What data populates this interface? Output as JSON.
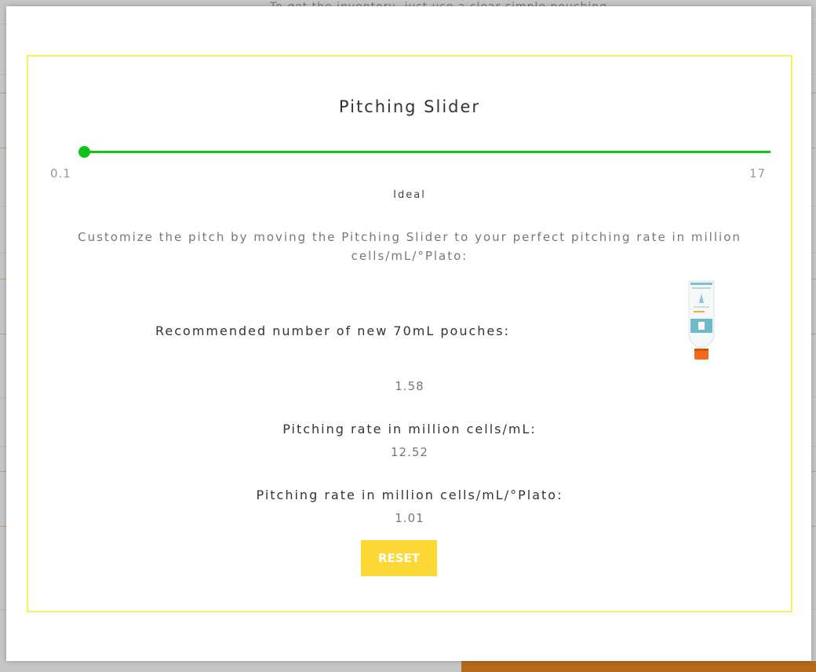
{
  "background": {
    "partial_text": "To get the inventory, just use a clear simple pouching"
  },
  "modal": {
    "title": "Pitching Slider",
    "slider": {
      "min_label": "0.1",
      "max_label": "17",
      "value": 0.1,
      "min": 0.1,
      "max": 17,
      "ideal_label": "Ideal",
      "color": "#10c31a"
    },
    "instructions": "Customize the pitch by moving the Pitching Slider to your perfect pitching rate in million cells/mL/°Plato:",
    "pouches": {
      "label": "Recommended number of new 70mL pouches:",
      "value": "1.58"
    },
    "rate": {
      "label": "Pitching rate in million cells/mL:",
      "value": "12.52"
    },
    "rate_plato": {
      "label": "Pitching rate in million cells/mL/°Plato:",
      "value": "1.01"
    },
    "reset_label": "RESET",
    "colors": {
      "frame_border": "#f5ef5b",
      "reset_bg": "#fdd835"
    }
  }
}
